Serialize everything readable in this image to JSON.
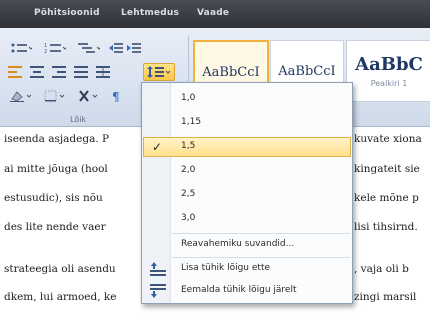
{
  "ribbon": {
    "tabs": [
      "Põhitsioonid",
      "Lehtmedus",
      "Vaade"
    ],
    "group_label": "Lõik",
    "style_gallery": [
      {
        "name": "AaBbCcI",
        "sub": ""
      },
      {
        "name": "AaBbCcI",
        "sub": ""
      },
      {
        "name": "AaBbC",
        "sub": "Pealkiri 1"
      }
    ]
  },
  "document": {
    "lines": [
      "iseenda asjadega. P",
      "ai mitte jõuga (hool",
      "estusudic), sis nõu",
      "des lite nende vaer",
      "strateegia oli asendu",
      "dkem, lui armoed, ke"
    ],
    "right_fragments": [
      "kuvate xiona",
      "kingateit sie",
      "kele mõne p",
      "lisi tihsirnd.",
      ", vaja oli b",
      "zingi marsil"
    ]
  },
  "line_spacing_menu": {
    "options": [
      "1,0",
      "1,15",
      "1,5",
      "2,0",
      "2,5",
      "3,0"
    ],
    "selected": "1,5",
    "more_options": "Reavahemiku suvandid...",
    "add_space_before": "Lisa tühik lõigu ette",
    "remove_space_after": "Eemalda tühik lõigu järelt"
  },
  "colors": {
    "highlight": "#ffe08c",
    "accent": "#f2b13c"
  }
}
